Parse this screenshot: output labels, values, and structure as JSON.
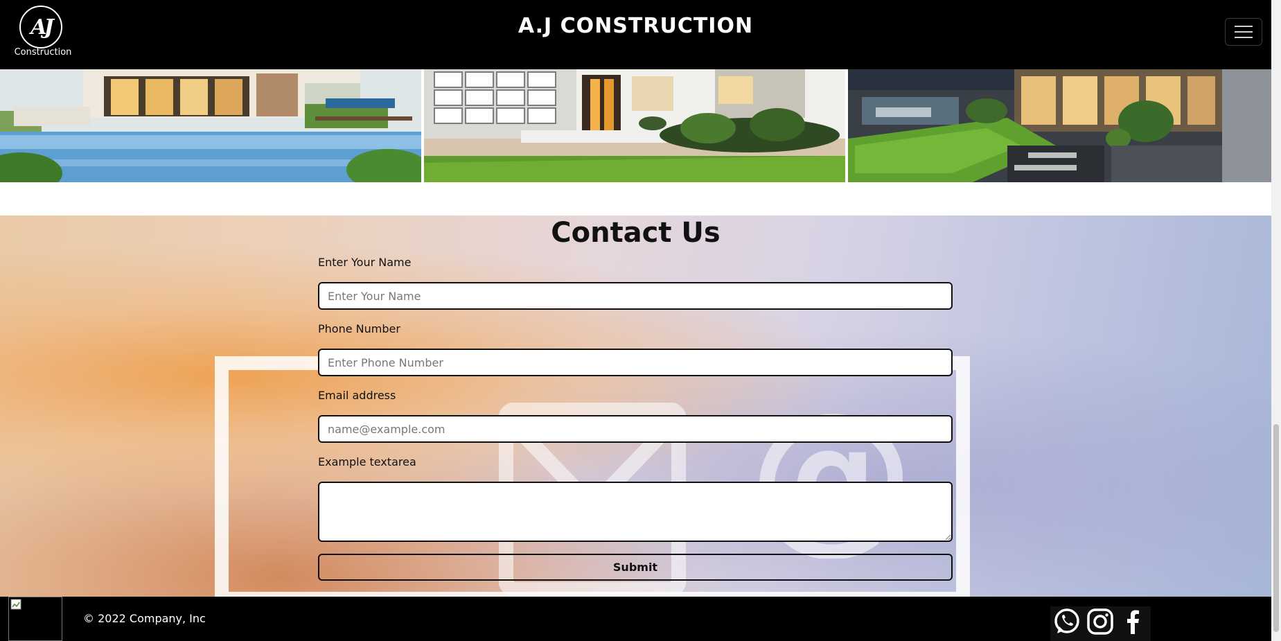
{
  "header": {
    "logo_mark": "AJ",
    "logo_text": "Construction",
    "title": "A.J CONSTRUCTION",
    "menu_icon": "hamburger-icon"
  },
  "gallery": {
    "photos": [
      {
        "subject": "modern house with swimming pool"
      },
      {
        "subject": "house entrance with lawn and garage"
      },
      {
        "subject": "luxury patio with lawn and lounge"
      }
    ]
  },
  "contact": {
    "title": "Contact Us",
    "name_label": "Enter Your Name",
    "name_placeholder": "Enter Your Name",
    "phone_label": "Phone Number",
    "phone_placeholder": "Enter Phone Number",
    "email_label": "Email address",
    "email_placeholder": "name@example.com",
    "message_label": "Example textarea",
    "message_value": "",
    "submit_label": "Submit"
  },
  "footer": {
    "copyright": "© 2022 Company, Inc",
    "social_icons": [
      "whatsapp-icon",
      "instagram-icon",
      "facebook-icon"
    ]
  },
  "colors": {
    "header_bg": "#000000",
    "footer_bg": "#000000",
    "text": "#111111"
  }
}
